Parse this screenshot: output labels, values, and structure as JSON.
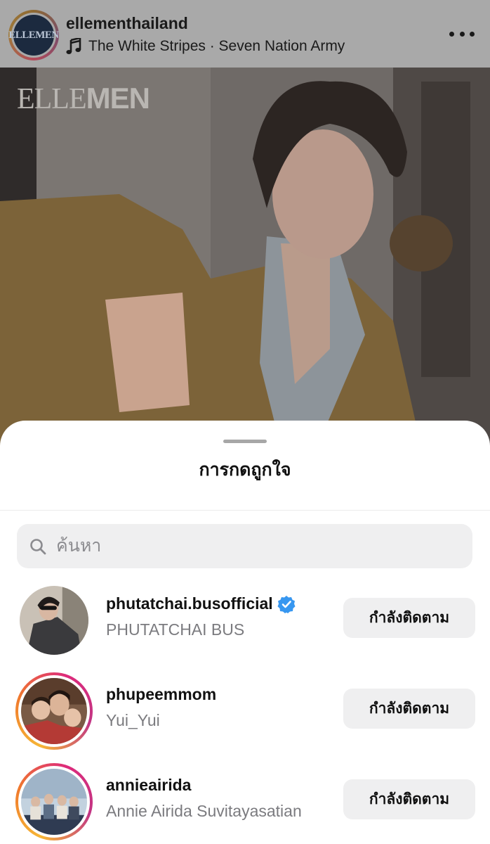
{
  "post": {
    "username": "ellementhailand",
    "music": "The White Stripes · Seven Nation Army",
    "avatar_logo": "ELLEMEN",
    "image_brand_thin": "ELLE",
    "image_brand_bold": "MEN",
    "icons": {
      "music": "music-note-icon",
      "more": "more-options-icon"
    }
  },
  "sheet": {
    "title": "การกดถูกใจ",
    "search": {
      "placeholder": "ค้นหา",
      "value": "",
      "icon": "search-icon"
    }
  },
  "likes": [
    {
      "username": "phutatchai.busofficial",
      "full_name": "PHUTATCHAI BUS",
      "verified": true,
      "story_ring": false,
      "button_label": "กำลังติดตาม"
    },
    {
      "username": "phupeemmom",
      "full_name": "Yui_Yui",
      "verified": false,
      "story_ring": true,
      "button_label": "กำลังติดตาม"
    },
    {
      "username": "annieairida",
      "full_name": "Annie Airida Suvitayasatian",
      "verified": false,
      "story_ring": true,
      "button_label": "กำลังติดตาม"
    }
  ],
  "colors": {
    "verified": "#3797f0",
    "button_bg": "#efeff0",
    "secondary_text": "#7b7b7f",
    "dim_overlay": "#a9a9a9"
  }
}
